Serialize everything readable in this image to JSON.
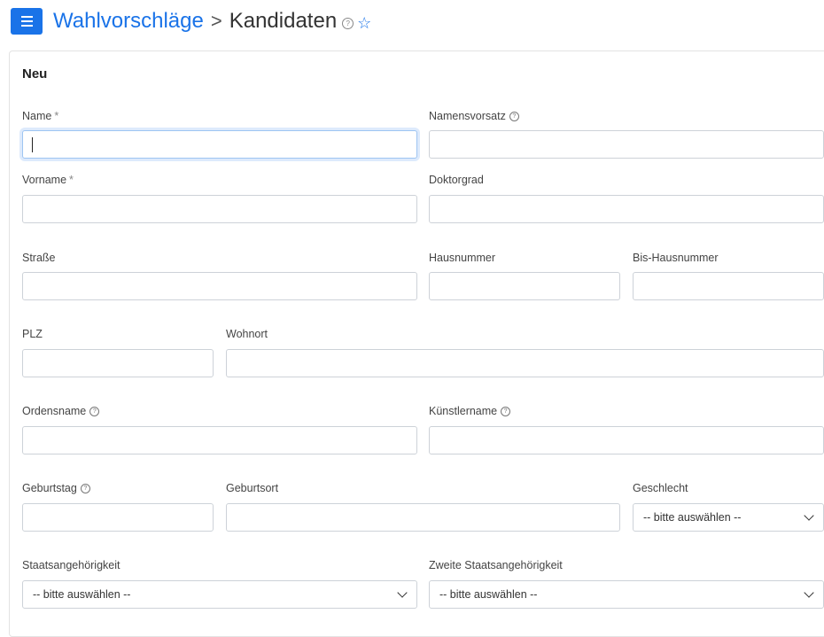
{
  "header": {
    "breadcrumb_link": "Wahlvorschläge",
    "separator": ">",
    "current": "Kandidaten"
  },
  "panel": {
    "title": "Neu"
  },
  "fields": {
    "name": {
      "label": "Name",
      "required_mark": "*",
      "value": ""
    },
    "namensvorsatz": {
      "label": "Namensvorsatz",
      "value": ""
    },
    "vorname": {
      "label": "Vorname",
      "required_mark": "*",
      "value": ""
    },
    "doktorgrad": {
      "label": "Doktorgrad",
      "value": ""
    },
    "strasse": {
      "label": "Straße",
      "value": ""
    },
    "hausnummer": {
      "label": "Hausnummer",
      "value": ""
    },
    "bis_hausnummer": {
      "label": "Bis-Hausnummer",
      "value": ""
    },
    "plz": {
      "label": "PLZ",
      "value": ""
    },
    "wohnort": {
      "label": "Wohnort",
      "value": ""
    },
    "ordensname": {
      "label": "Ordensname",
      "value": ""
    },
    "kuenstlername": {
      "label": "Künstlername",
      "value": ""
    },
    "geburtstag": {
      "label": "Geburtstag",
      "value": ""
    },
    "geburtsort": {
      "label": "Geburtsort",
      "value": ""
    },
    "geschlecht": {
      "label": "Geschlecht",
      "selected": "-- bitte auswählen --"
    },
    "staatsangehoerigkeit": {
      "label": "Staatsangehörigkeit",
      "selected": "-- bitte auswählen --"
    },
    "zweite_staatsangehoerigkeit": {
      "label": "Zweite Staatsangehörigkeit",
      "selected": "-- bitte auswählen --"
    }
  },
  "icons": {
    "menu": "hamburger-menu-icon",
    "help": "help-circle-icon",
    "favorite": "star-outline-icon",
    "dropdown": "chevron-down-icon"
  },
  "colors": {
    "accent": "#1a73e8",
    "border": "#cdd2d8"
  }
}
